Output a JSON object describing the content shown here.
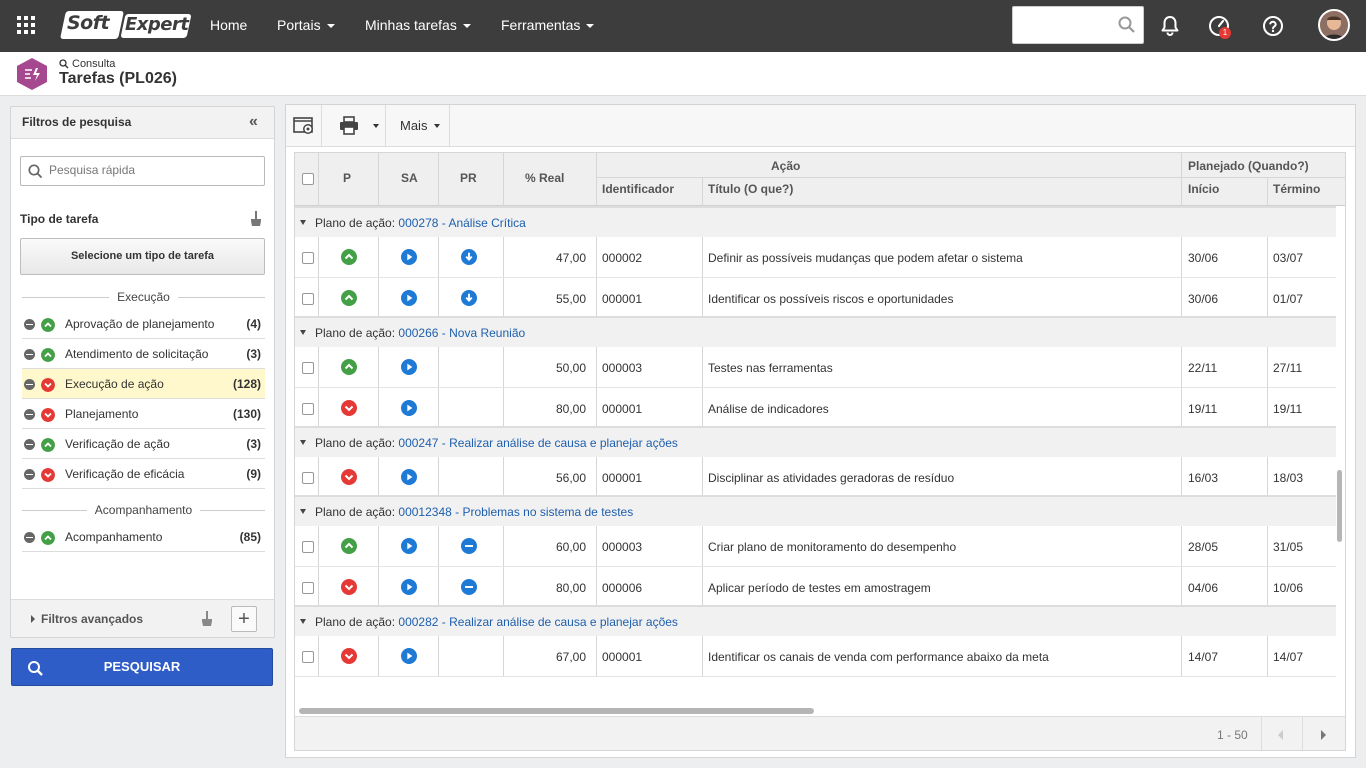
{
  "topbar": {
    "logo_part1": "Soft",
    "logo_part2": "Expert",
    "nav": [
      "Home",
      "Portais",
      "Minhas tarefas",
      "Ferramentas"
    ],
    "notification_count": "1"
  },
  "header": {
    "breadcrumb": "Consulta",
    "title": "Tarefas (PL026)"
  },
  "filters": {
    "title": "Filtros de pesquisa",
    "quick_search_placeholder": "Pesquisa rápida",
    "task_type_title": "Tipo de tarefa",
    "task_type_button": "Selecione um tipo de tarefa",
    "group_execution": "Execução",
    "group_follow": "Acompanhamento",
    "items": [
      {
        "label": "Aprovação de planejamento",
        "count": "(4)",
        "status": "up"
      },
      {
        "label": "Atendimento de solicitação",
        "count": "(3)",
        "status": "up"
      },
      {
        "label": "Execução de ação",
        "count": "(128)",
        "status": "down"
      },
      {
        "label": "Planejamento",
        "count": "(130)",
        "status": "down"
      },
      {
        "label": "Verificação de ação",
        "count": "(3)",
        "status": "up"
      },
      {
        "label": "Verificação de eficácia",
        "count": "(9)",
        "status": "down"
      },
      {
        "label": "Acompanhamento",
        "count": "(85)",
        "status": "up"
      }
    ],
    "advanced": "Filtros avançados",
    "search_button": "PESQUISAR"
  },
  "toolbar": {
    "more": "Mais"
  },
  "grid": {
    "headers": {
      "p": "P",
      "sa": "SA",
      "pr": "PR",
      "real": "% Real",
      "acao": "Ação",
      "id": "Identificador",
      "titulo": "Título (O que?)",
      "planejado": "Planejado (Quando?)",
      "inicio": "Início",
      "termino": "Término"
    },
    "group_prefix": "Plano de ação:",
    "groups": [
      {
        "link": "000278 -  Análise Crítica",
        "rows": [
          {
            "p": "up",
            "sa": "play",
            "pr": "down",
            "real": "47,00",
            "id": "000002",
            "title": "Definir as possíveis mudanças que podem afetar o sistema",
            "start": "30/06",
            "end": "03/07"
          },
          {
            "p": "up",
            "sa": "play",
            "pr": "down",
            "real": "55,00",
            "id": "000001",
            "title": "Identificar os possíveis riscos e oportunidades",
            "start": "30/06",
            "end": "01/07"
          }
        ]
      },
      {
        "link": "000266 - Nova Reunião",
        "rows": [
          {
            "p": "up",
            "sa": "play",
            "pr": "",
            "real": "50,00",
            "id": "000003",
            "title": "Testes nas ferramentas",
            "start": "22/11",
            "end": "27/11"
          },
          {
            "p": "down",
            "sa": "play",
            "pr": "",
            "real": "80,00",
            "id": "000001",
            "title": "Análise de indicadores",
            "start": "19/11",
            "end": "19/11"
          }
        ]
      },
      {
        "link": " 000247 - Realizar análise de causa e planejar ações",
        "rows": [
          {
            "p": "down",
            "sa": "play",
            "pr": "",
            "real": "56,00",
            "id": "000001",
            "title": "Disciplinar as atividades geradoras de resíduo",
            "start": "16/03",
            "end": "18/03"
          }
        ]
      },
      {
        "link": "00012348 - Problemas no sistema de testes",
        "rows": [
          {
            "p": "up",
            "sa": "play",
            "pr": "minus",
            "real": "60,00",
            "id": "000003",
            "title": "Criar plano de monitoramento do desempenho",
            "start": "28/05",
            "end": "31/05"
          },
          {
            "p": "down",
            "sa": "play",
            "pr": "minus",
            "real": "80,00",
            "id": "000006",
            "title": "Aplicar período de testes em amostragem",
            "start": "04/06",
            "end": "10/06"
          }
        ]
      },
      {
        "link": "000282 - Realizar análise de causa e planejar ações",
        "rows": [
          {
            "p": "down",
            "sa": "play",
            "pr": "",
            "real": "67,00",
            "id": "000001",
            "title": "Identificar os canais de venda com performance abaixo da meta",
            "start": "14/07",
            "end": "14/07"
          }
        ]
      }
    ],
    "pager": "1 - 50"
  },
  "colors": {
    "green": "#43a047",
    "red": "#e53935",
    "blue": "#1f7ad6",
    "button": "#2f5dc7"
  }
}
